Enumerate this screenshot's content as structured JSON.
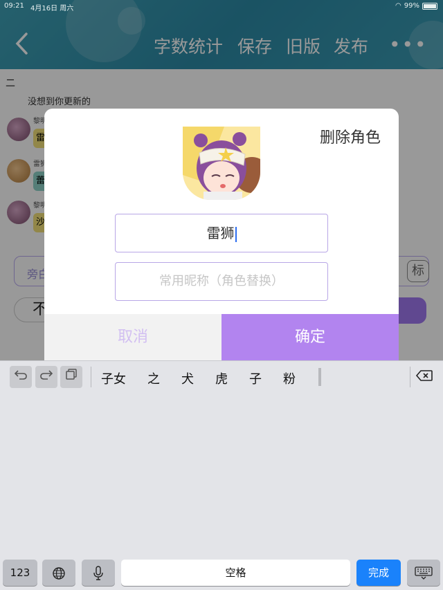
{
  "status_bar": {
    "time": "09:21",
    "date": "4月16日 周六",
    "battery": "99%"
  },
  "header": {
    "back_icon": "chevron-left-icon",
    "buttons": [
      "字数统计",
      "保存",
      "旧版",
      "发布"
    ],
    "more_icon": "ellipsis-icon"
  },
  "page": {
    "chapter_mark": "二",
    "chat_line": "没想到你更新的",
    "rows": [
      {
        "name": "黎明",
        "tag": "雷"
      },
      {
        "name": "雷狮",
        "tag": "蕾"
      },
      {
        "name": "黎明",
        "tag": "沙"
      }
    ],
    "input_placeholder": "旁白",
    "tag_label": "标",
    "left_btn": "不"
  },
  "dialog": {
    "delete_label": "删除角色",
    "avatar_icon": "character-avatar",
    "name_value": "雷狮",
    "nickname_placeholder": "常用昵称（角色替换）",
    "cancel_label": "取消",
    "confirm_label": "确定"
  },
  "keyboard": {
    "tools": [
      "undo-icon",
      "redo-icon",
      "copy-icon"
    ],
    "candidates": [
      "子女",
      "之",
      "犬",
      "虎",
      "子",
      "粉"
    ],
    "delete_icon": "backspace-icon",
    "keys": {
      "numbers": "123",
      "globe": "globe-icon",
      "mic": "mic-icon",
      "space": "空格",
      "done": "完成",
      "hide": "keyboard-hide-icon"
    }
  },
  "colors": {
    "header": "#2c8aa6",
    "accent": "#b284ef",
    "cancel_text": "#d2bff2",
    "done_key": "#1a82fb"
  }
}
